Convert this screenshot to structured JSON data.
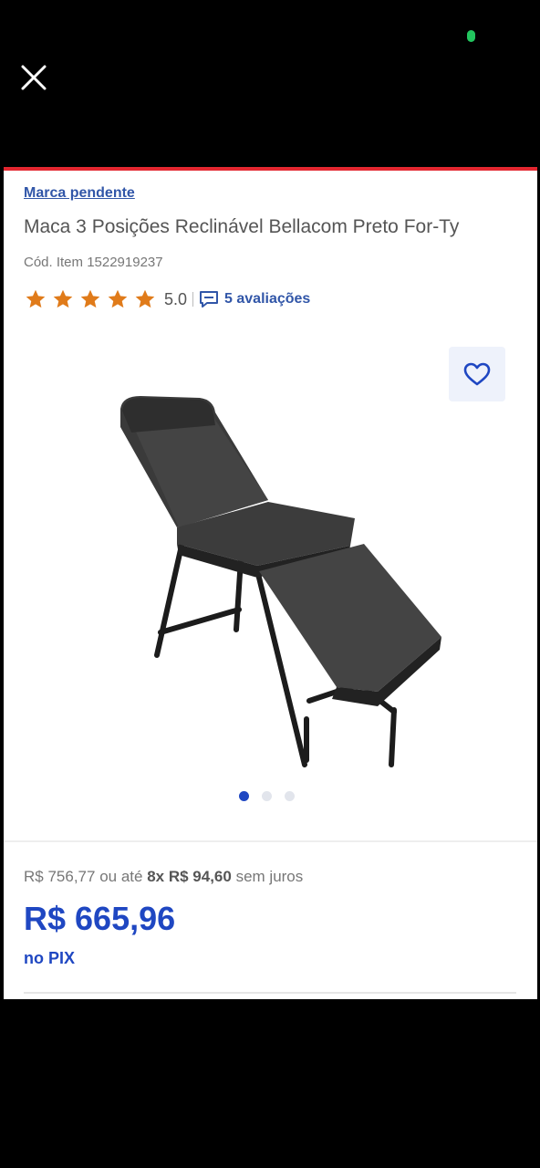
{
  "brand": "Marca pendente",
  "title": "Maca 3 Posições Reclinável Bellacom Preto For-Ty",
  "item_code": "Cód. Item 1522919237",
  "rating": {
    "stars_filled": 5,
    "stars_total": 5,
    "value": "5.0",
    "reviews_label": "5 avaliações"
  },
  "carousel": {
    "total": 3,
    "active_index": 0
  },
  "price": {
    "original": "R$ 756,77",
    "connector": "ou até",
    "installments": "8x",
    "installment_value": "R$ 94,60",
    "installment_suffix": "sem juros",
    "pix_price": "R$ 665,96",
    "pix_label": "no PIX"
  },
  "colors": {
    "accent_blue": "#1f47c2",
    "link_blue": "#3156a8",
    "star": "#e07b1a",
    "top_bar": "#e3262f"
  },
  "icons": [
    "close-icon",
    "star-icon",
    "review-icon",
    "heart-icon"
  ]
}
